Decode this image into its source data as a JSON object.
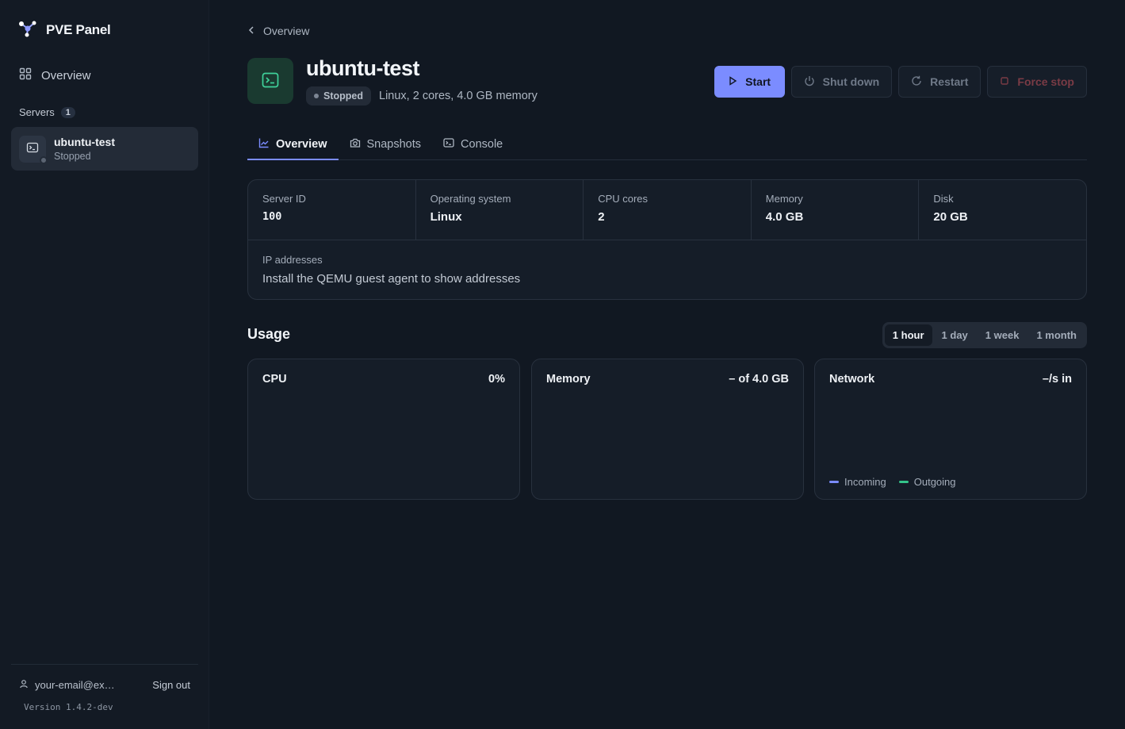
{
  "app": {
    "title": "PVE Panel"
  },
  "sidebar": {
    "overview_label": "Overview",
    "servers_label": "Servers",
    "servers_count": "1",
    "servers": [
      {
        "name": "ubuntu-test",
        "status": "Stopped"
      }
    ],
    "user_email": "your-email@exampl...",
    "sign_out": "Sign out",
    "version": "Version 1.4.2-dev"
  },
  "breadcrumb": {
    "back_label": "Overview"
  },
  "vm": {
    "name": "ubuntu-test",
    "status": "Stopped",
    "summary": "Linux, 2 cores, 4.0 GB memory"
  },
  "actions": {
    "start": "Start",
    "shutdown": "Shut down",
    "restart": "Restart",
    "force_stop": "Force stop"
  },
  "tabs": [
    {
      "label": "Overview",
      "active": true
    },
    {
      "label": "Snapshots",
      "active": false
    },
    {
      "label": "Console",
      "active": false
    }
  ],
  "info": {
    "server_id_label": "Server ID",
    "server_id": "100",
    "os_label": "Operating system",
    "os": "Linux",
    "cpu_label": "CPU cores",
    "cpu": "2",
    "memory_label": "Memory",
    "memory": "4.0 GB",
    "disk_label": "Disk",
    "disk": "20 GB",
    "ip_label": "IP addresses",
    "ip_value": "Install the QEMU guest agent to show addresses"
  },
  "usage": {
    "title": "Usage",
    "ranges": [
      "1 hour",
      "1 day",
      "1 week",
      "1 month"
    ],
    "active_range": "1 hour",
    "cpu": {
      "label": "CPU",
      "value": "0%"
    },
    "memory": {
      "label": "Memory",
      "value": "– of 4.0 GB"
    },
    "network": {
      "label": "Network",
      "value": "–/s in",
      "legend_in": "Incoming",
      "legend_out": "Outgoing"
    }
  },
  "colors": {
    "accent": "#7b8cff",
    "incoming": "#7b8cff",
    "outgoing": "#34c48a",
    "danger": "#7a3b45",
    "vm_icon": "#3fd19a"
  }
}
